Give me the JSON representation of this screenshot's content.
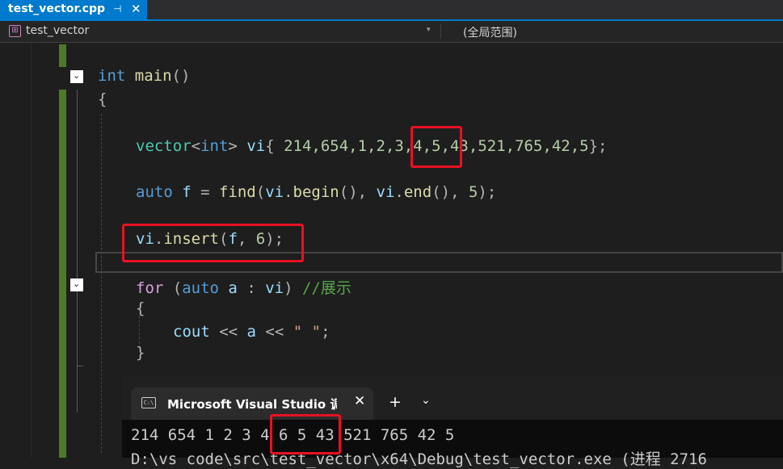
{
  "tab": {
    "title": "test_vector.cpp",
    "pin_glyph": "⊣",
    "close_glyph": "✕"
  },
  "nav": {
    "scope_icon": "⊞",
    "left_scope": "test_vector",
    "dropdown_glyph": "▾",
    "right_scope": "(全局范围)"
  },
  "fold_glyph": "⌄",
  "code": {
    "line1": {
      "kw": "int",
      "fn": "main",
      "rest": "()"
    },
    "line2": "{",
    "line3": {
      "type": "vector",
      "lt": "<",
      "kw": "int",
      "gt": ">",
      "var": " vi",
      "brace_open": "{",
      "nums": " 214,654,1,2,3,4,5,43,521,765,42,5",
      "brace_close": "}",
      "semi": ";"
    },
    "line4": {
      "kw": "auto",
      "var": " f",
      "eq": " = ",
      "fn": "find",
      "p1": "(",
      "v1": "vi",
      "dot1": ".",
      "f2": "begin",
      "p2": "(), ",
      "v2": "vi",
      "dot2": ".",
      "f3": "end",
      "p3": "(), ",
      "num": "5",
      "p4": ");"
    },
    "line5": {
      "var": "vi",
      "dot": ".",
      "fn": "insert",
      "p1": "(",
      "arg": "f",
      "comma": ", ",
      "num": "6",
      "p2": ");"
    },
    "line6": {
      "kw": "for",
      "p1": " (",
      "kw2": "auto",
      "var": " a",
      "colon": " : ",
      "var2": "vi",
      "p2": ")",
      "cmt": " //展示"
    },
    "line7": "{",
    "line8": {
      "var": "cout",
      "op1": " << ",
      "v": "a",
      "op2": " << ",
      "str": "\" \"",
      "semi": ";"
    },
    "line9": "}"
  },
  "console": {
    "icon": "C:\\",
    "title": "Microsoft Visual Studio 调试控制台",
    "close_glyph": "✕",
    "new_glyph": "+",
    "dropdown_glyph": "⌄",
    "output_line": "214 654 1 2 3 4 6 5 43 521 765 42 5",
    "path_line": "D:\\vs code\\src\\test_vector\\x64\\Debug\\test_vector.exe (进程 2716"
  }
}
